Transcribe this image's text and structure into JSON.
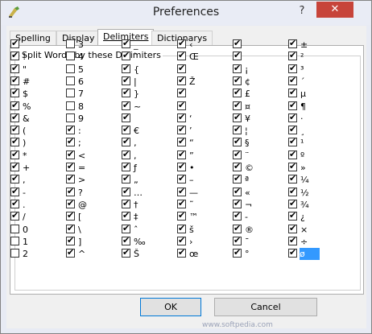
{
  "window": {
    "title": "Preferences",
    "help_label": "?",
    "close_label": "✕"
  },
  "tabs": [
    {
      "label": "Spelling",
      "active": false
    },
    {
      "label": "Display",
      "active": false
    },
    {
      "label": "Delimiters",
      "active": true
    },
    {
      "label": "Dictionarys",
      "active": false
    }
  ],
  "group_title": "Split Words by these Delimiters",
  "columns": [
    [
      {
        "label": "",
        "checked": true
      },
      {
        "label": "!",
        "checked": true
      },
      {
        "label": "\"",
        "checked": true
      },
      {
        "label": "#",
        "checked": true
      },
      {
        "label": "$",
        "checked": true
      },
      {
        "label": "%",
        "checked": true
      },
      {
        "label": "&",
        "checked": true
      },
      {
        "label": "(",
        "checked": true
      },
      {
        "label": ")",
        "checked": true
      },
      {
        "label": "*",
        "checked": true
      },
      {
        "label": "+",
        "checked": true
      },
      {
        "label": ",",
        "checked": true
      },
      {
        "label": "-",
        "checked": true
      },
      {
        "label": ".",
        "checked": true
      },
      {
        "label": "/",
        "checked": true
      },
      {
        "label": "0",
        "checked": false
      },
      {
        "label": "1",
        "checked": false
      },
      {
        "label": "2",
        "checked": false
      }
    ],
    [
      {
        "label": "3",
        "checked": false
      },
      {
        "label": "4",
        "checked": false
      },
      {
        "label": "5",
        "checked": false
      },
      {
        "label": "6",
        "checked": false
      },
      {
        "label": "7",
        "checked": false
      },
      {
        "label": "8",
        "checked": false
      },
      {
        "label": "9",
        "checked": false
      },
      {
        "label": ":",
        "checked": true
      },
      {
        "label": ";",
        "checked": true
      },
      {
        "label": "<",
        "checked": true
      },
      {
        "label": "=",
        "checked": true
      },
      {
        "label": ">",
        "checked": true
      },
      {
        "label": "?",
        "checked": true
      },
      {
        "label": "@",
        "checked": true
      },
      {
        "label": "[",
        "checked": true
      },
      {
        "label": "\\",
        "checked": true
      },
      {
        "label": "]",
        "checked": true
      },
      {
        "label": "^",
        "checked": true
      }
    ],
    [
      {
        "label": "_",
        "checked": true
      },
      {
        "label": "`",
        "checked": true
      },
      {
        "label": "{",
        "checked": true
      },
      {
        "label": "|",
        "checked": true
      },
      {
        "label": "}",
        "checked": true
      },
      {
        "label": "~",
        "checked": true
      },
      {
        "label": "",
        "checked": true
      },
      {
        "label": "€",
        "checked": true
      },
      {
        "label": "‚",
        "checked": true
      },
      {
        "label": ",",
        "checked": true
      },
      {
        "label": "ƒ",
        "checked": true
      },
      {
        "label": "„",
        "checked": true
      },
      {
        "label": "…",
        "checked": true
      },
      {
        "label": "†",
        "checked": true
      },
      {
        "label": "‡",
        "checked": true
      },
      {
        "label": "ˆ",
        "checked": true
      },
      {
        "label": "‰",
        "checked": true
      },
      {
        "label": "Š",
        "checked": true
      }
    ],
    [
      {
        "label": "‹",
        "checked": true
      },
      {
        "label": "Œ",
        "checked": true
      },
      {
        "label": "",
        "checked": true
      },
      {
        "label": "Ž",
        "checked": true
      },
      {
        "label": "",
        "checked": true
      },
      {
        "label": "",
        "checked": true
      },
      {
        "label": "‘",
        "checked": true
      },
      {
        "label": "’",
        "checked": true
      },
      {
        "label": "“",
        "checked": true
      },
      {
        "label": "”",
        "checked": true
      },
      {
        "label": "•",
        "checked": true
      },
      {
        "label": "–",
        "checked": true
      },
      {
        "label": "—",
        "checked": true
      },
      {
        "label": "˜",
        "checked": true
      },
      {
        "label": "™",
        "checked": true
      },
      {
        "label": "š",
        "checked": true
      },
      {
        "label": "›",
        "checked": true
      },
      {
        "label": "œ",
        "checked": true
      }
    ],
    [
      {
        "label": "",
        "checked": true
      },
      {
        "label": "",
        "checked": true
      },
      {
        "label": "¡",
        "checked": true
      },
      {
        "label": "¢",
        "checked": true
      },
      {
        "label": "£",
        "checked": true
      },
      {
        "label": "¤",
        "checked": true
      },
      {
        "label": "¥",
        "checked": true
      },
      {
        "label": "¦",
        "checked": true
      },
      {
        "label": "§",
        "checked": true
      },
      {
        "label": "¨",
        "checked": true
      },
      {
        "label": "©",
        "checked": true
      },
      {
        "label": "ª",
        "checked": true
      },
      {
        "label": "«",
        "checked": true
      },
      {
        "label": "¬",
        "checked": true
      },
      {
        "label": "-",
        "checked": true
      },
      {
        "label": "®",
        "checked": true
      },
      {
        "label": "¯",
        "checked": true
      },
      {
        "label": "°",
        "checked": true
      }
    ],
    [
      {
        "label": "±",
        "checked": true
      },
      {
        "label": "²",
        "checked": true
      },
      {
        "label": "³",
        "checked": true
      },
      {
        "label": "´",
        "checked": true
      },
      {
        "label": "µ",
        "checked": true
      },
      {
        "label": "¶",
        "checked": true
      },
      {
        "label": "·",
        "checked": true
      },
      {
        "label": "¸",
        "checked": true
      },
      {
        "label": "¹",
        "checked": true
      },
      {
        "label": "º",
        "checked": true
      },
      {
        "label": "»",
        "checked": true
      },
      {
        "label": "¼",
        "checked": true
      },
      {
        "label": "½",
        "checked": true
      },
      {
        "label": "¾",
        "checked": true
      },
      {
        "label": "¿",
        "checked": true
      },
      {
        "label": "×",
        "checked": true
      },
      {
        "label": "÷",
        "checked": true
      },
      {
        "label": "ø",
        "checked": true,
        "selected": true
      }
    ]
  ],
  "buttons": {
    "ok_label": "OK",
    "cancel_label": "Cancel"
  },
  "watermark": "www.softpedia.com"
}
